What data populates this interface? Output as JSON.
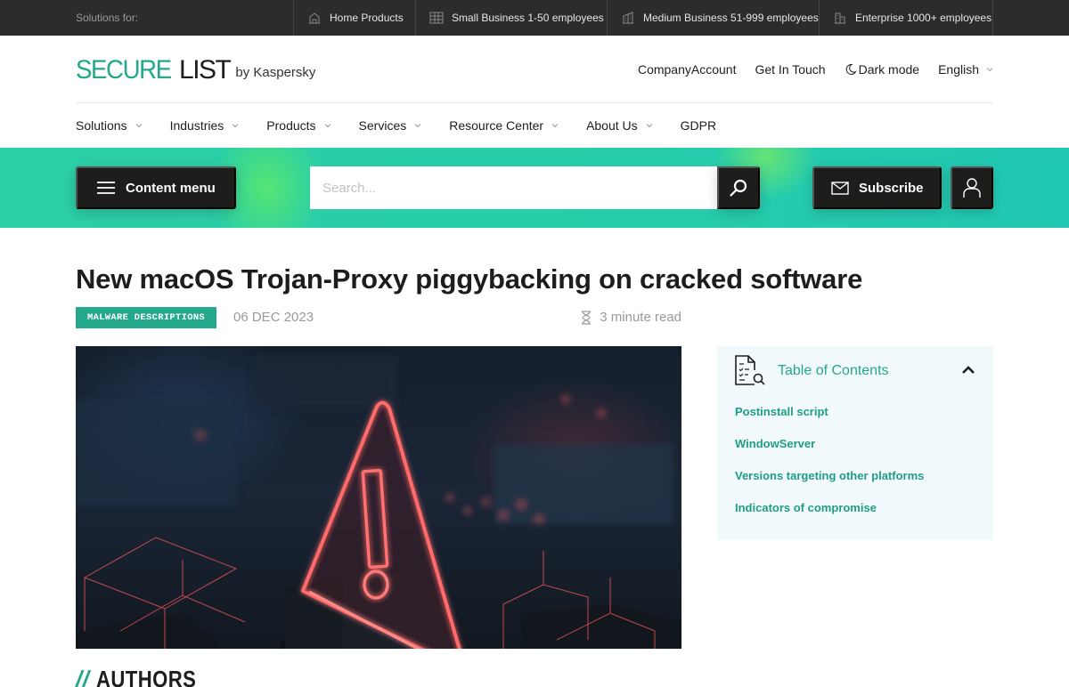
{
  "topbar": {
    "label": "Solutions for:",
    "segments": [
      {
        "label": "Home Products",
        "icon": "house-icon"
      },
      {
        "label": "Small Business 1-50 employees",
        "icon": "small-building-icon"
      },
      {
        "label": "Medium Business 51-999 employees",
        "icon": "medium-building-icon"
      },
      {
        "label": "Enterprise 1000+ employees",
        "icon": "enterprise-building-icon"
      }
    ]
  },
  "header": {
    "logo_secure": "SECURE",
    "logo_list": "LIST",
    "logo_by": "by Kaspersky",
    "links": {
      "company_account": "CompanyAccount",
      "get_in_touch": "Get In Touch",
      "dark_mode": "Dark mode",
      "language": "English"
    }
  },
  "nav": {
    "items": [
      {
        "label": "Solutions",
        "has_dropdown": true
      },
      {
        "label": "Industries",
        "has_dropdown": true
      },
      {
        "label": "Products",
        "has_dropdown": true
      },
      {
        "label": "Services",
        "has_dropdown": true
      },
      {
        "label": "Resource Center",
        "has_dropdown": true
      },
      {
        "label": "About Us",
        "has_dropdown": true
      },
      {
        "label": "GDPR",
        "has_dropdown": false
      }
    ]
  },
  "toolbar": {
    "content_menu": "Content menu",
    "search_placeholder": "Search...",
    "search_value": "",
    "subscribe": "Subscribe"
  },
  "article": {
    "title": "New macOS Trojan-Proxy piggybacking on cracked software",
    "category": "MALWARE DESCRIPTIONS",
    "date": "06 DEC 2023",
    "read_time": "3 minute read",
    "hero_alt": "Glowing red warning triangle on dark circuit board"
  },
  "toc": {
    "title": "Table of Contents",
    "items": [
      "Postinstall script",
      "WindowServer",
      "Versions targeting other platforms",
      "Indicators of compromise"
    ]
  },
  "authors": {
    "slashes": "//",
    "heading": "AUTHORS"
  },
  "colors": {
    "brand_teal": "#23a88b",
    "topbar_bg": "#2c2c2c",
    "button_dark": "#1d1d1b",
    "toc_bg": "#f3fafd"
  }
}
